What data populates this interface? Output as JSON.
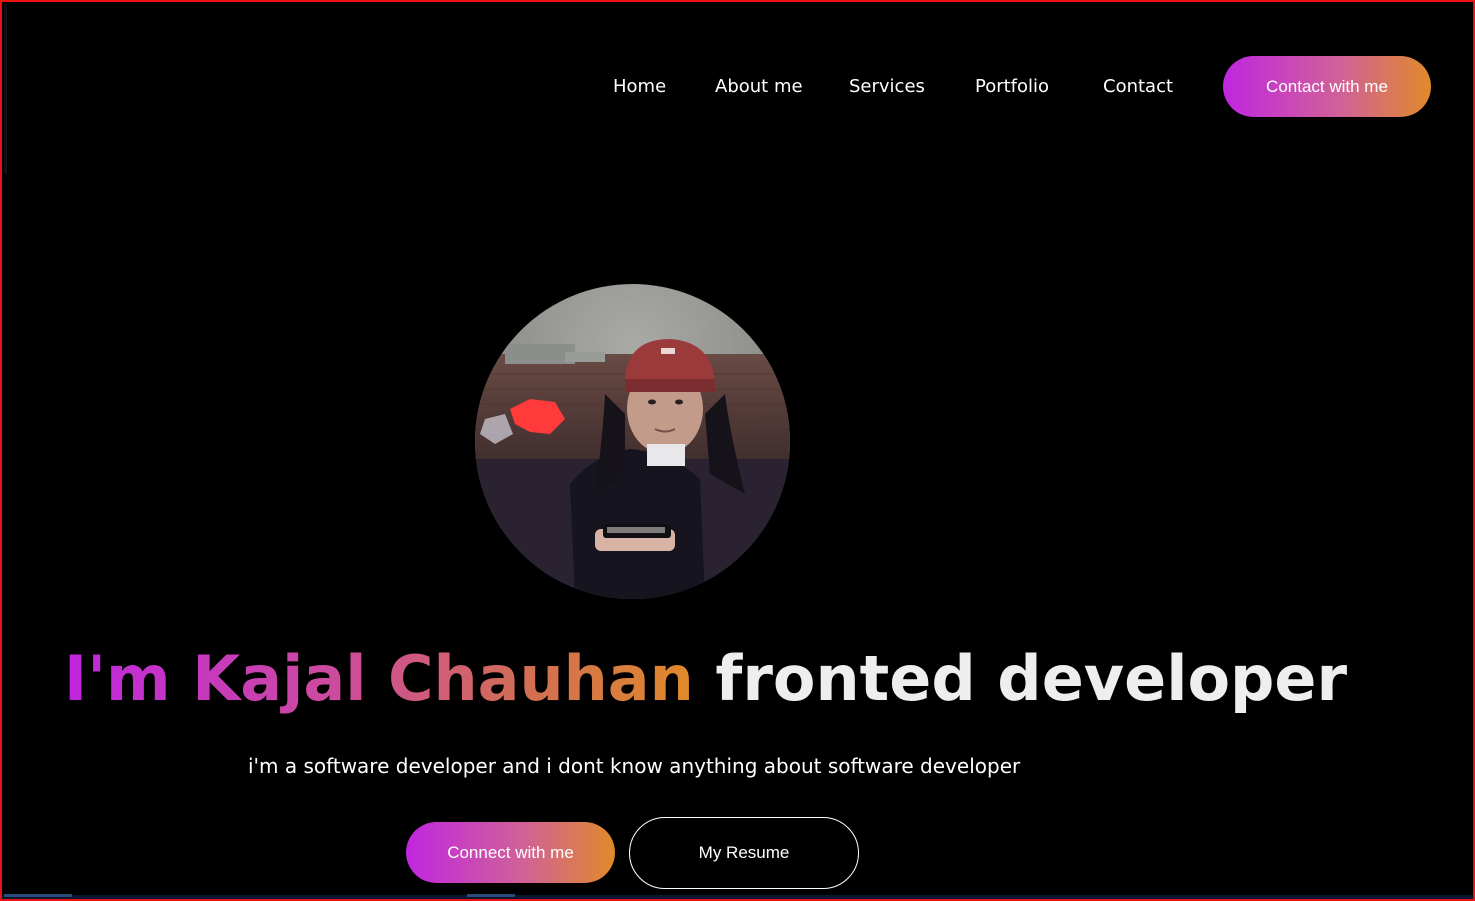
{
  "nav": {
    "items": [
      {
        "label": "Home"
      },
      {
        "label": "About me"
      },
      {
        "label": "Services"
      },
      {
        "label": "Portfolio"
      },
      {
        "label": "Contact"
      }
    ],
    "cta_label": "Contact with me"
  },
  "hero": {
    "name_text": "I'm Kajal Chauhan",
    "role_text": "fronted developer",
    "tagline": "i'm a software developer and i dont know anything about software developer",
    "primary_button": "Connect with me",
    "secondary_button": "My Resume"
  },
  "colors": {
    "background": "#000000",
    "accent_start": "#c026e0",
    "accent_end": "#e08a2a",
    "text": "#ffffff",
    "frame_border": "#ee1111"
  },
  "icons": {
    "avatar": "profile-photo"
  }
}
